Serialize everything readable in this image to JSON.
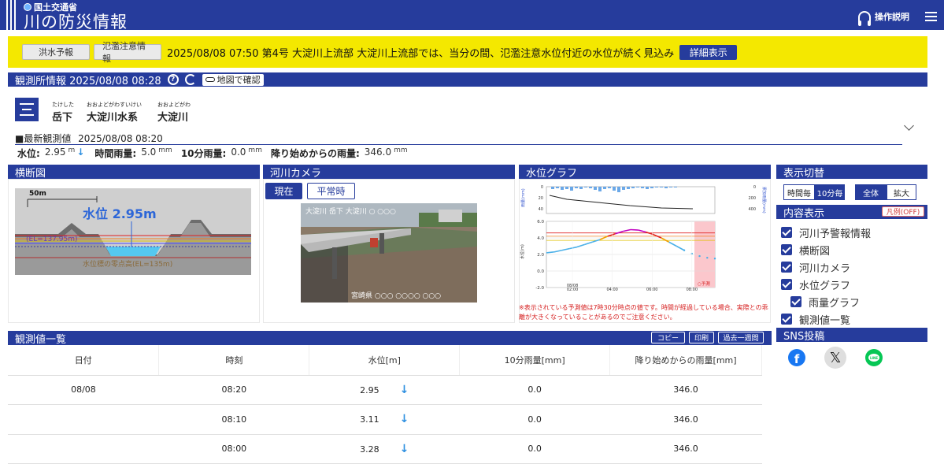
{
  "header": {
    "ministry": "国土交通省",
    "title": "川の防災情報",
    "help_label": "操作説明"
  },
  "alert": {
    "flood_forecast_btn": "洪水予報",
    "overflow_info_btn": "氾濫注意情報",
    "message": "2025/08/08 07:50 第4号  大淀川上流部  大淀川上流部では、当分の間、氾濫注意水位付近の水位が続く見込み",
    "detail_btn": "詳細表示"
  },
  "station": {
    "heading": "観測所情報 2025/08/08 08:28",
    "map_btn": "地図で確認",
    "name_ruby": "たけした",
    "name": "岳下",
    "system_ruby": "おおよどがわすいけい",
    "system": "大淀川水系",
    "river_ruby": "おおよどがわ",
    "river": "大淀川",
    "latest_label": "■最新観測値",
    "latest_time": "2025/08/08 08:20",
    "readings": {
      "level_label": "水位:",
      "level_value": "2.95",
      "level_unit": "m",
      "hourly_rain_label": "時間雨量:",
      "hourly_rain_value": "5.0",
      "tenmin_rain_label": "10分雨量:",
      "tenmin_rain_value": "0.0",
      "cumulative_label": "降り始めからの雨量:",
      "cumulative_value": "346.0",
      "rain_unit": "mm",
      "trend_arrow": "↓"
    }
  },
  "panels": {
    "cross_section": {
      "title": "横断図",
      "scale_label": "50m",
      "level_label": "水位 2.95m",
      "elevation_label": "(EL=137.95m)",
      "zero_label": "水位標の零点高(EL=135m)"
    },
    "camera": {
      "title": "河川カメラ",
      "tab_now": "現在",
      "tab_normal": "平常時",
      "overlay_top": "大淀川 岳下 大淀川 ○ ○○○",
      "overlay_bottom": "宮崎県 ○○○ ○○○○ ○○○"
    },
    "water_graph": {
      "title": "水位グラフ",
      "rain_axis_label": "雨量(mm)",
      "cum_axis_label": "累加雨量(mm)",
      "level_axis_label": "水位(m)",
      "forecast_label": "○予測",
      "note": "※表示されている予測値は7時30分時点の値です。時間が経過している場合、実際との乖離が大きくなっていることがあるのでご注意ください。"
    }
  },
  "chart_data": {
    "type": "line",
    "title": "",
    "xlabel": "",
    "ylabel": "水位(m)",
    "x_ticks": [
      "08/08 02:00",
      "04:00",
      "06:00",
      "08:00"
    ],
    "ylim": [
      -2.0,
      6.0
    ],
    "y_ticks": [
      -2.0,
      0.0,
      2.0,
      4.0,
      6.0
    ],
    "rain_y_ticks": [
      0,
      20,
      40
    ],
    "cum_y_ticks": [
      0,
      200,
      400
    ],
    "series": [
      {
        "name": "",
        "x": [
          0,
          0.5,
          1,
          1.5,
          2,
          2.5,
          3,
          3.5,
          4,
          4.5,
          5,
          5.5,
          6,
          6.5,
          7,
          7.5,
          8,
          8.5,
          9
        ],
        "values": [
          2.2,
          2.3,
          2.5,
          2.7,
          2.9,
          3.2,
          3.5,
          3.8,
          4.2,
          4.5,
          4.8,
          5.0,
          4.95,
          4.7,
          4.4,
          4.0,
          3.5,
          3.0,
          2.5
        ]
      },
      {
        "name": "○予測",
        "x": [
          9,
          9.5,
          10,
          10.5,
          11
        ],
        "values": [
          2.5,
          2.1,
          1.8,
          1.6,
          1.5
        ]
      }
    ]
  },
  "sidebar": {
    "display_toggle_title": "表示切替",
    "seg_hourly": "時間毎",
    "seg_10min": "10分毎",
    "seg_all": "全体",
    "seg_zoom": "拡大",
    "content_title": "内容表示",
    "legend_btn": "凡例(OFF)",
    "items": [
      {
        "label": "河川予警報情報"
      },
      {
        "label": "横断図"
      },
      {
        "label": "河川カメラ"
      },
      {
        "label": "水位グラフ"
      },
      {
        "label": "雨量グラフ"
      },
      {
        "label": "観測値一覧"
      }
    ],
    "sns_title": "SNS投稿"
  },
  "obs_list": {
    "title": "観測値一覧",
    "copy_btn": "コピー",
    "print_btn": "印刷",
    "past_week_btn": "過去一週間",
    "columns": [
      "日付",
      "時刻",
      "水位[m]",
      "10分雨量[mm]",
      "降り始めからの雨量[mm]"
    ],
    "rows": [
      {
        "date": "08/08",
        "time": "08:20",
        "level": "2.95",
        "arrow": "↓",
        "rain10": "0.0",
        "cum": "346.0"
      },
      {
        "date": "",
        "time": "08:10",
        "level": "3.11",
        "arrow": "↓",
        "rain10": "0.0",
        "cum": "346.0"
      },
      {
        "date": "",
        "time": "08:00",
        "level": "3.28",
        "arrow": "↓",
        "rain10": "0.0",
        "cum": "346.0"
      }
    ]
  }
}
